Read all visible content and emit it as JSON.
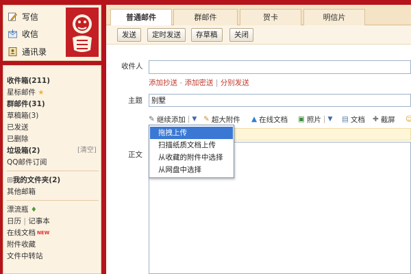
{
  "quick": {
    "write": "写信",
    "receive": "收信",
    "contacts": "通讯录"
  },
  "folders": {
    "inbox": "收件箱(211)",
    "starred": "星标邮件",
    "group": "群邮件(31)",
    "drafts": "草稿箱(3)",
    "sent": "已发送",
    "deleted": "已删除",
    "spam": "垃圾箱(2)",
    "clear": "[清空]",
    "qq_sub": "QQ邮件订阅",
    "my_folders": "我的文件夹(2)",
    "other": "其他邮箱",
    "drift": "漂流瓶",
    "calendar": "日历",
    "notebook": "记事本",
    "online_docs": "在线文档",
    "new_badge": "NEW",
    "attachments": "附件收藏",
    "transfer": "文件中转站"
  },
  "tabs": [
    "普通邮件",
    "群邮件",
    "贺卡",
    "明信片"
  ],
  "toolbar": {
    "send": "发送",
    "timed": "定时发送",
    "draft": "存草稿",
    "close": "关闭"
  },
  "compose": {
    "to_label": "收件人",
    "cc_link": "添加抄送",
    "bcc_link": "添加密送",
    "separate_link": "分别发送",
    "subject_label": "主题",
    "subject_value": "别墅",
    "body_label": "正文"
  },
  "attach_bar": {
    "continue_add": "继续添加",
    "super_attach": "超大附件",
    "online_doc": "在线文档",
    "photo": "照片",
    "document": "文档",
    "screenshot": "截屏"
  },
  "dropdown": {
    "items": [
      "拖拽上传",
      "扫描纸质文档上传",
      "从收藏的附件中选择",
      "从网盘中选择"
    ]
  },
  "colors": {
    "frame": "#b5141c",
    "panel": "#fbf2e2",
    "link": "#c0392b",
    "highlight": "#3a78d4"
  }
}
